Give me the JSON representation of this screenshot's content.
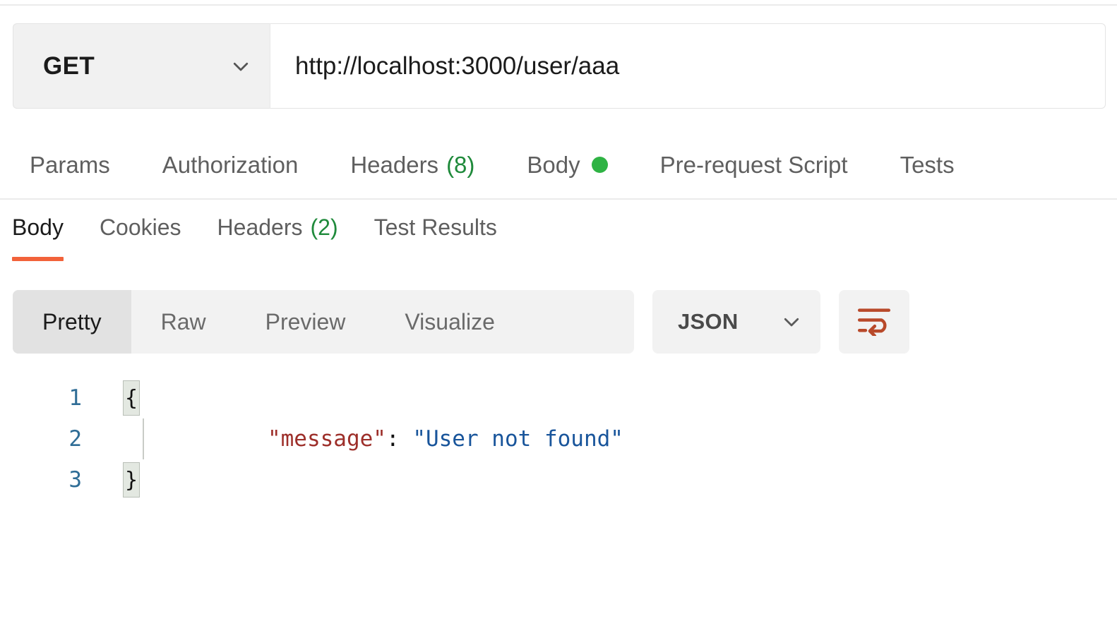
{
  "request": {
    "method": "GET",
    "method_dropdown_icon": "chevron-down-icon",
    "url": "http://localhost:3000/user/aaa",
    "url_placeholder": "Enter request URL",
    "tabs": [
      {
        "label": "Params",
        "badge": "",
        "dot": false,
        "active": false
      },
      {
        "label": "Authorization",
        "badge": "",
        "dot": false,
        "active": false
      },
      {
        "label": "Headers",
        "badge": "(8)",
        "dot": false,
        "active": false
      },
      {
        "label": "Body",
        "badge": "",
        "dot": true,
        "active": false
      },
      {
        "label": "Pre-request Script",
        "badge": "",
        "dot": false,
        "active": false
      },
      {
        "label": "Tests",
        "badge": "",
        "dot": false,
        "active": false
      }
    ]
  },
  "response": {
    "tabs": [
      {
        "label": "Body",
        "badge": "",
        "active": true
      },
      {
        "label": "Cookies",
        "badge": "",
        "active": false
      },
      {
        "label": "Headers",
        "badge": "(2)",
        "active": false
      },
      {
        "label": "Test Results",
        "badge": "",
        "active": false
      }
    ],
    "view_modes": [
      {
        "label": "Pretty",
        "active": true
      },
      {
        "label": "Raw",
        "active": false
      },
      {
        "label": "Preview",
        "active": false
      },
      {
        "label": "Visualize",
        "active": false
      }
    ],
    "language": "JSON",
    "language_dropdown_icon": "chevron-down-icon",
    "wrap_button_icon": "wrap-text-icon",
    "body_lines": [
      {
        "number": "1",
        "fold": "{",
        "fold_type": "box",
        "tokens": []
      },
      {
        "number": "2",
        "fold": "",
        "fold_type": "empty",
        "tokens": [
          {
            "text": "\"message\"",
            "type": "key"
          },
          {
            "text": ":",
            "type": "punct"
          },
          {
            "text": " ",
            "type": "punct"
          },
          {
            "text": "\"User not found\"",
            "type": "str"
          }
        ]
      },
      {
        "number": "3",
        "fold": "}",
        "fold_type": "box",
        "tokens": []
      }
    ]
  },
  "colors": {
    "accent_orange": "#f2623a",
    "status_green": "#2fb344",
    "count_green": "#1f8a3b",
    "json_key": "#9d2f2a",
    "json_string": "#19559b",
    "line_number": "#2f6d96",
    "wrap_icon": "#b8492a"
  }
}
